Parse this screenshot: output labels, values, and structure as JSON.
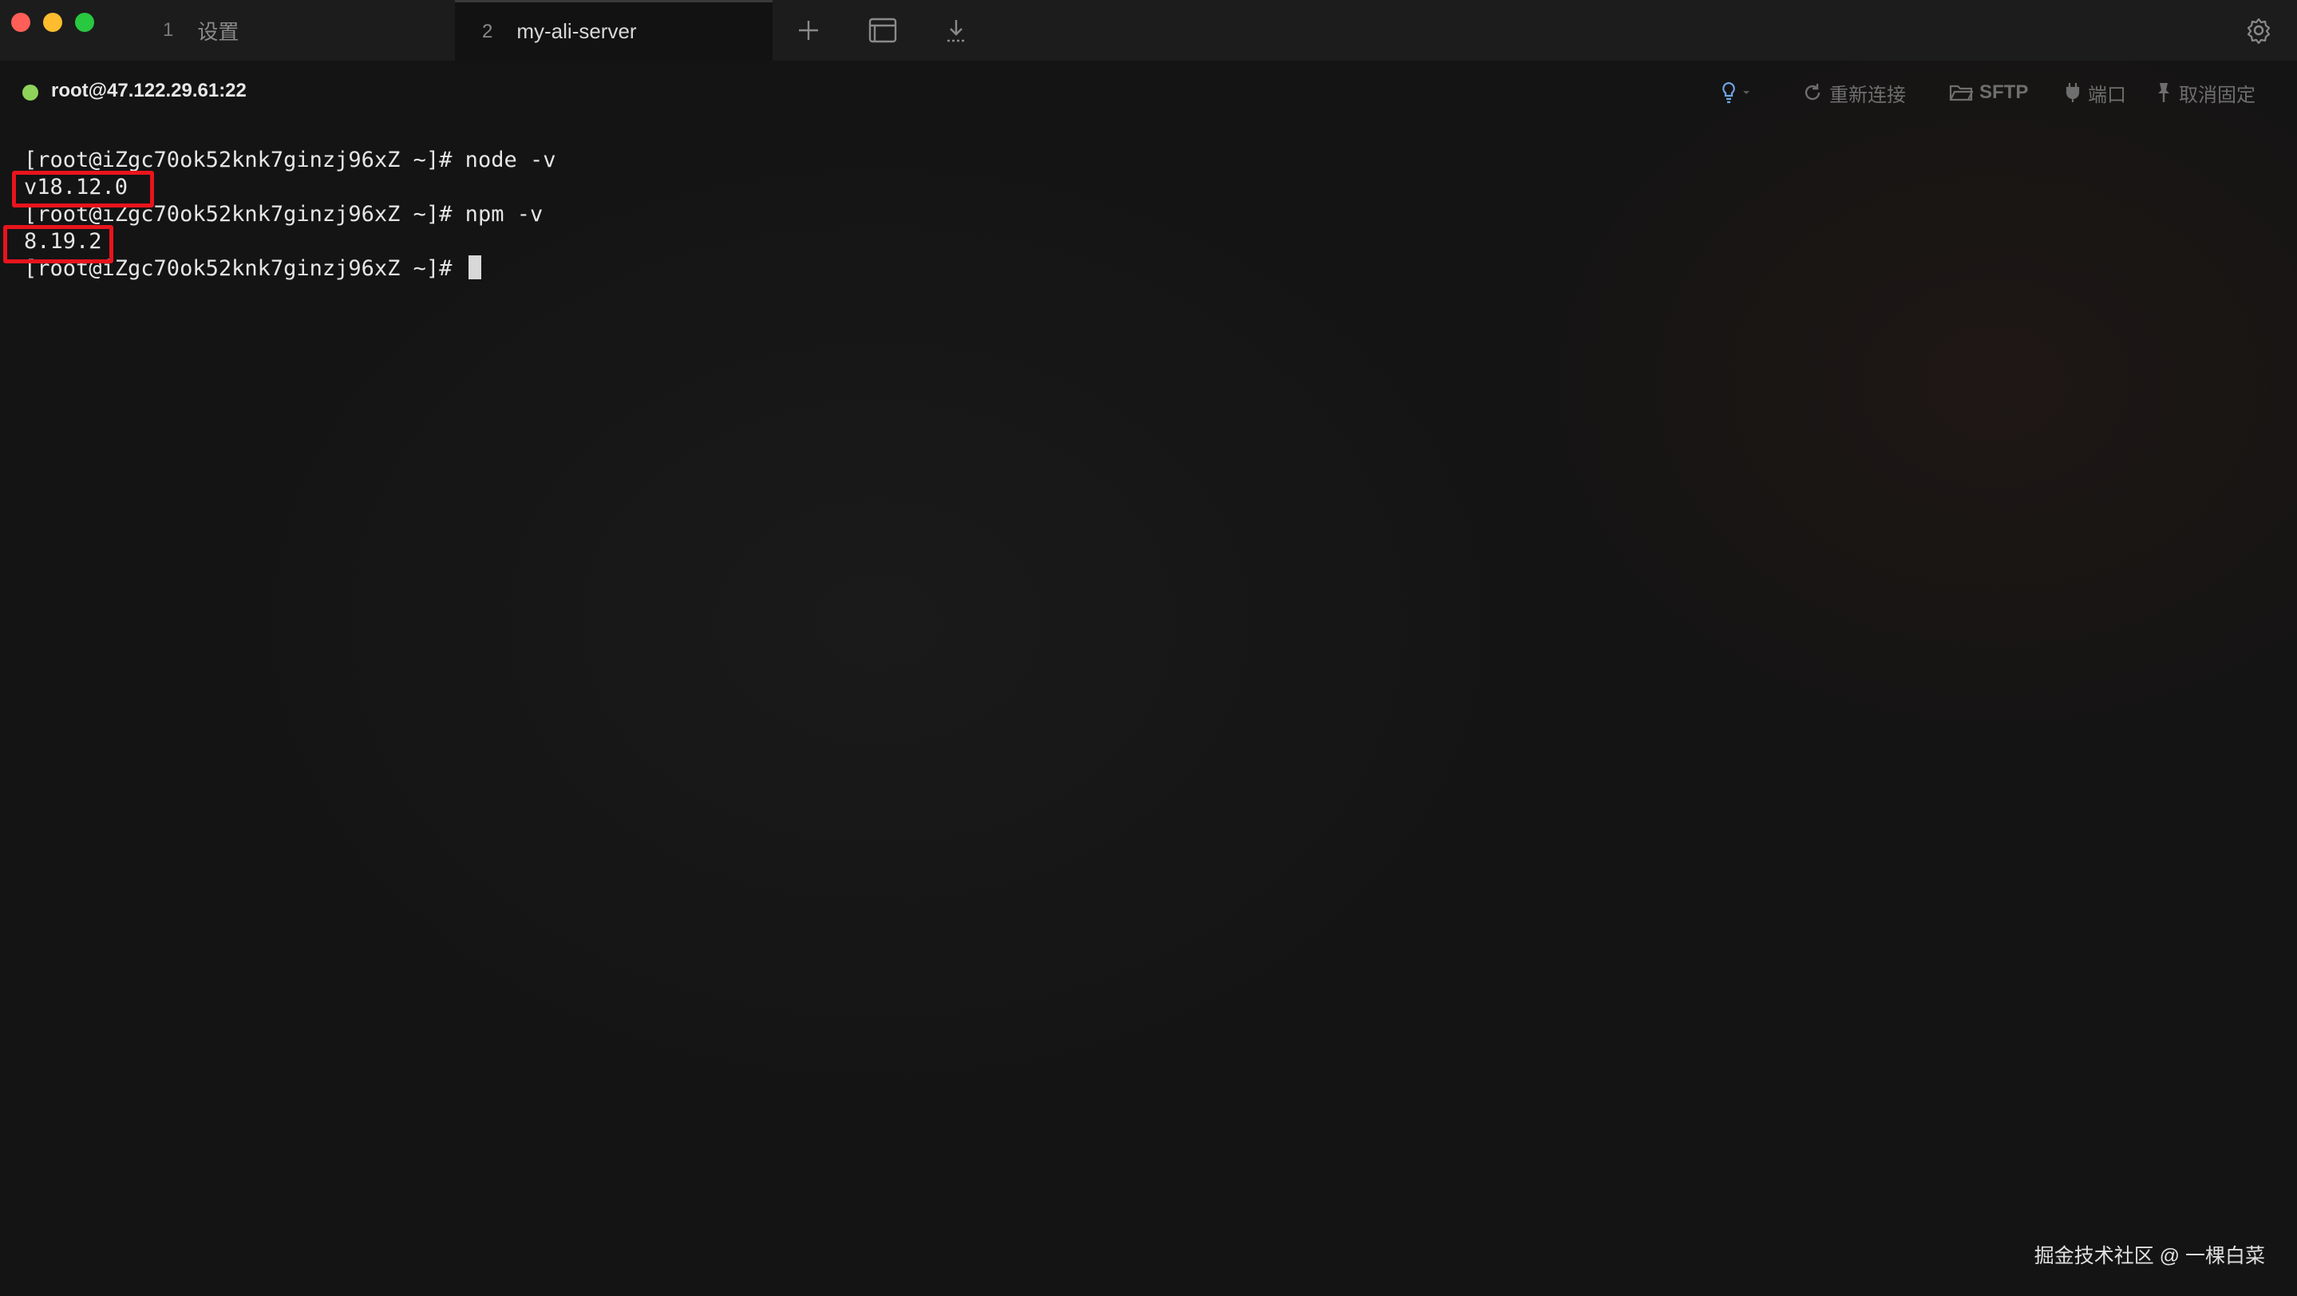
{
  "tabs": [
    {
      "number": "1",
      "label": "设置"
    },
    {
      "number": "2",
      "label": "my-ali-server"
    }
  ],
  "toolbar_icons": [
    "plus-icon",
    "window-icon",
    "download-icon"
  ],
  "connection": {
    "label": "root@47.122.29.61:22",
    "status_color": "#8fd35a"
  },
  "actions": {
    "reconnect": "重新连接",
    "sftp": "SFTP",
    "port": "端口",
    "unpin": "取消固定"
  },
  "terminal": {
    "lines": [
      "[root@iZgc70ok52knk7ginzj96xZ ~]# node -v",
      "v18.12.0",
      "[root@iZgc70ok52knk7ginzj96xZ ~]# npm -v",
      "8.19.2",
      "[root@iZgc70ok52knk7ginzj96xZ ~]# "
    ]
  },
  "highlight_color": "#e8141c",
  "watermark": "掘金技术社区 @ 一棵白菜"
}
